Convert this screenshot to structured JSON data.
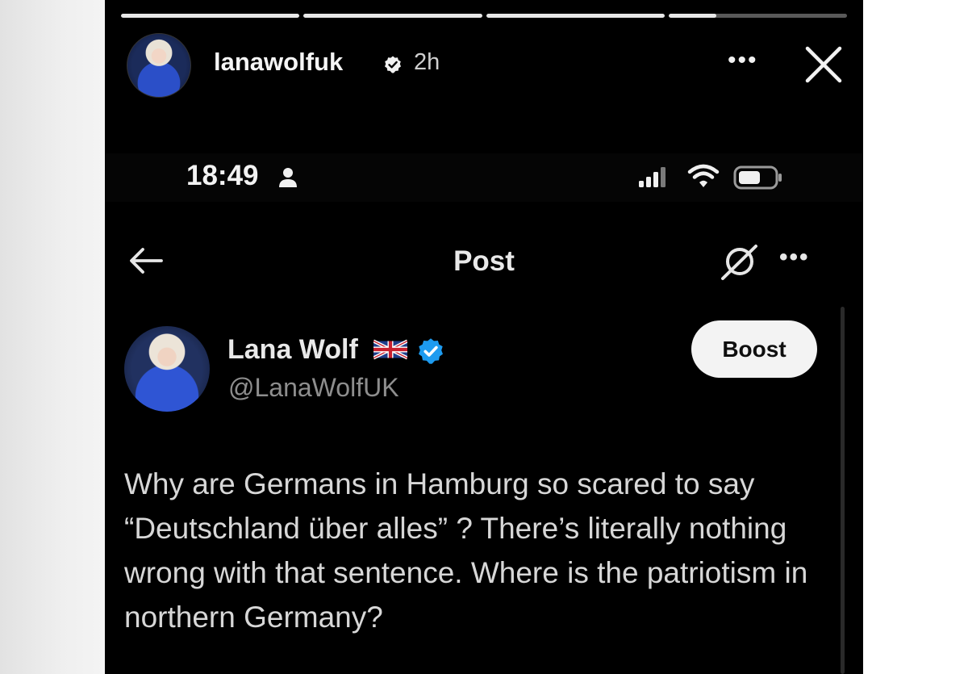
{
  "story": {
    "progress": [
      1,
      1,
      1,
      0.27
    ],
    "username": "lanawolfuk",
    "time": "2h",
    "more_label": "•••"
  },
  "phone": {
    "clock": "18:49"
  },
  "nav": {
    "title": "Post",
    "more_label": "•••"
  },
  "post": {
    "display_name": "Lana Wolf",
    "handle": "@LanaWolfUK",
    "boost_label": "Boost",
    "text": "Why are Germans in Hamburg so scared to say “Deutschland über alles” ? There’s literally nothing wrong with that sentence. Where is the patriotism in northern Germany?"
  },
  "colors": {
    "background": "#000000",
    "verified_blue": "#1d9bf0",
    "handle_gray": "#8e8e8e",
    "boost_bg": "#f3f3f3"
  },
  "icons": [
    "verified-badge-icon",
    "close-icon",
    "person-icon",
    "signal-icon",
    "wifi-icon",
    "battery-icon",
    "back-arrow-icon",
    "grok-icon",
    "uk-flag-icon",
    "blue-check-icon"
  ]
}
